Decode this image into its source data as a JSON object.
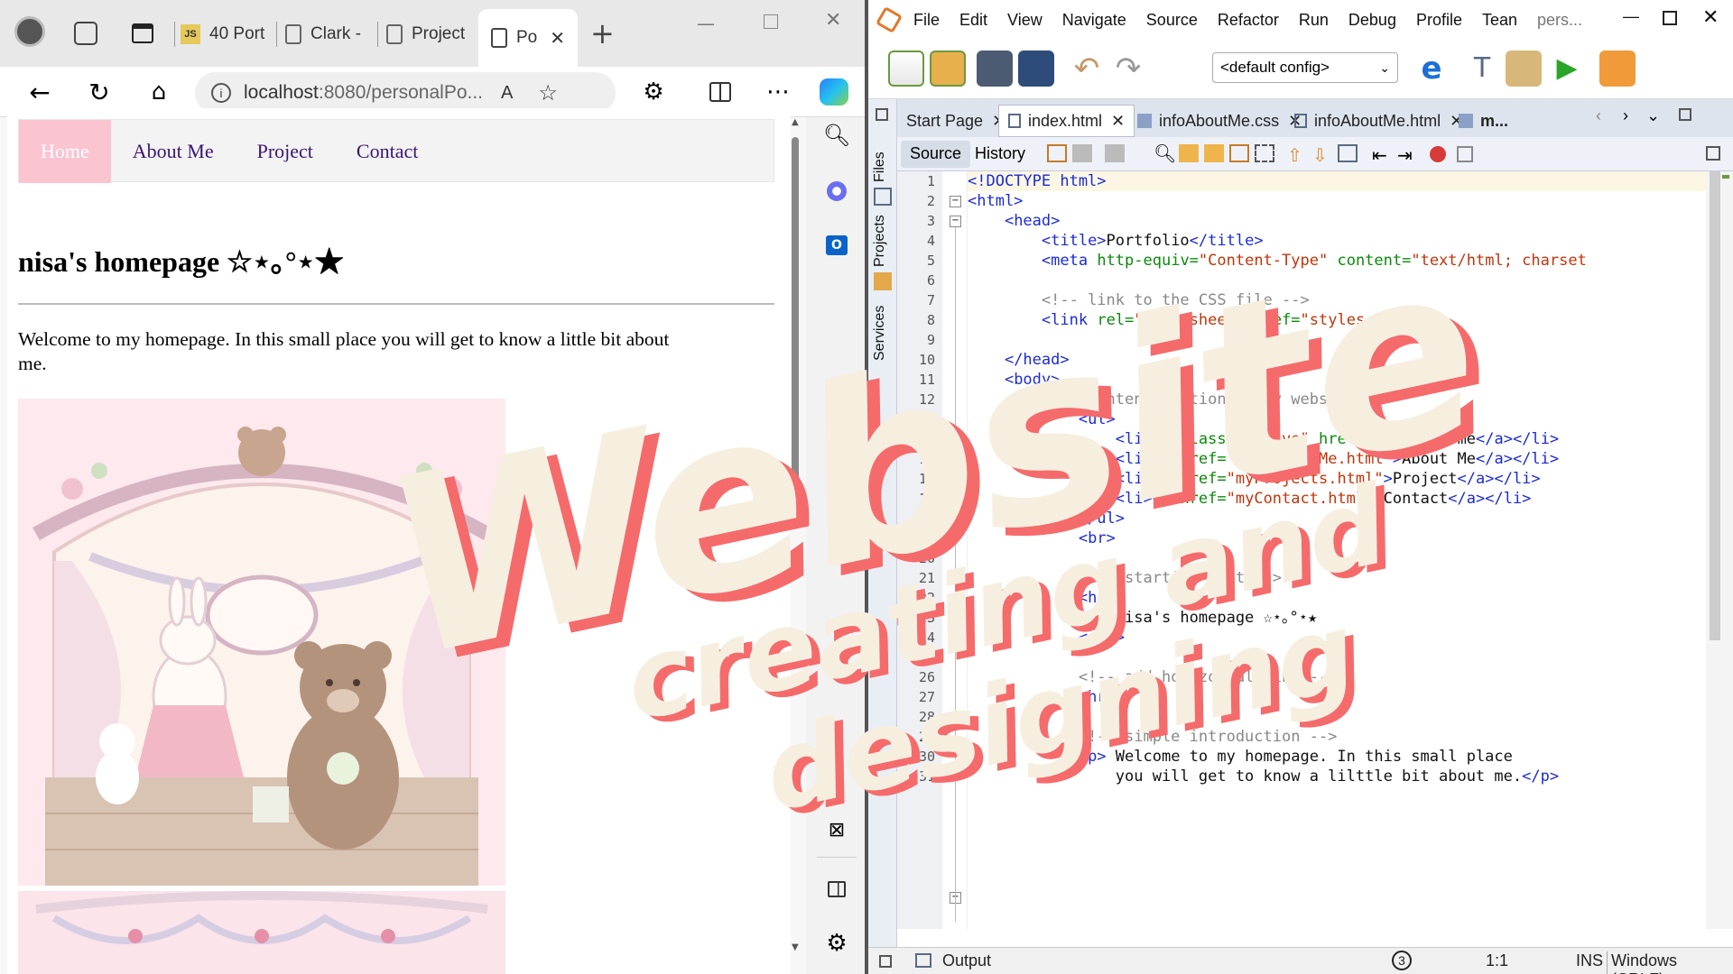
{
  "browser": {
    "tabs": [
      {
        "label": "40 Port",
        "icon": "js-icon"
      },
      {
        "label": "Clark -",
        "icon": "page-icon"
      },
      {
        "label": "Project",
        "icon": "page-icon"
      },
      {
        "label": "Po",
        "icon": "page-icon",
        "active": true
      }
    ],
    "url_host": "localhost",
    "url_rest": ":8080/personalPo...",
    "page": {
      "nav": [
        {
          "label": "Home",
          "active": true
        },
        {
          "label": "About Me"
        },
        {
          "label": "Project"
        },
        {
          "label": "Contact"
        }
      ],
      "title": "nisa's homepage ☆⋆｡°⋆★",
      "intro_line1": "Welcome to my homepage. In this small place you will get to know a little bit about",
      "intro_line2": "me."
    }
  },
  "ide": {
    "menu": [
      "File",
      "Edit",
      "View",
      "Navigate",
      "Source",
      "Refactor",
      "Run",
      "Debug",
      "Profile",
      "Tean",
      "pers..."
    ],
    "config": "<default config>",
    "side_tabs": [
      "Files",
      "Projects",
      "Services"
    ],
    "editor_tabs": [
      "Start Page",
      "index.html",
      "infoAboutMe.css",
      "infoAboutMe.html",
      "m..."
    ],
    "source_tab": "Source",
    "history_tab": "History",
    "code_lines": [
      {
        "n": "1",
        "html": "<span class='tag'>&lt;!DOCTYPE html&gt;</span>"
      },
      {
        "n": "2",
        "html": "<span class='tag'>&lt;html&gt;</span>"
      },
      {
        "n": "3",
        "html": "    <span class='tag'>&lt;head&gt;</span>"
      },
      {
        "n": "4",
        "html": "        <span class='tag'>&lt;title&gt;</span><span class='txt'>Portfolio</span><span class='tag'>&lt;/title&gt;</span>"
      },
      {
        "n": "5",
        "html": "        <span class='tag'>&lt;meta</span> <span class='att'>http-equiv=</span><span class='str'>\"Content-Type\"</span> <span class='att'>content=</span><span class='str'>\"text/html; charset</span>"
      },
      {
        "n": "6",
        "html": ""
      },
      {
        "n": "7",
        "html": "        <span class='com'>&lt;!-- link to the CSS file --&gt;</span>"
      },
      {
        "n": "8",
        "html": "        <span class='tag'>&lt;link</span> <span class='att'>rel=</span><span class='str'>\"stylesheet\"</span> <span class='att'>href=</span><span class='str'>\"styles.css\"</span><span class='tag'>&gt;</span>"
      },
      {
        "n": "9",
        "html": ""
      },
      {
        "n": "10",
        "html": "    <span class='tag'>&lt;/head&gt;</span>"
      },
      {
        "n": "11",
        "html": "    <span class='tag'>&lt;body&gt;</span>"
      },
      {
        "n": "12",
        "html": "        <span class='com'>&lt;!-- content section in my website --&gt;</span>"
      },
      {
        "n": "13",
        "html": "            <span class='tag'>&lt;ul&gt;</span>"
      },
      {
        "n": "14",
        "html": "                <span class='tag'>&lt;li&gt;&lt;a</span> <span class='att'>class=</span><span class='str'>\"active\"</span> <span class='att'>href=</span><span class='str'>\"#home\"</span><span class='tag'>&gt;</span><span class='txt'>Home</span><span class='tag'>&lt;/a&gt;&lt;/li&gt;</span>"
      },
      {
        "n": "15",
        "html": "                <span class='tag'>&lt;li&gt;&lt;a</span> <span class='att'>href=</span><span class='str'>\"infoAboutMe.html\"</span><span class='tag'>&gt;</span><span class='txt'>About Me</span><span class='tag'>&lt;/a&gt;&lt;/li&gt;</span>"
      },
      {
        "n": "16",
        "html": "                <span class='tag'>&lt;li&gt;&lt;a</span> <span class='att'>href=</span><span class='str'>\"myProjects.html\"</span><span class='tag'>&gt;</span><span class='txt'>Project</span><span class='tag'>&lt;/a&gt;&lt;/li&gt;</span>"
      },
      {
        "n": "17",
        "html": "                <span class='tag'>&lt;li&gt;&lt;a</span> <span class='att'>href=</span><span class='str'>\"myContact.html\"</span><span class='tag'>&gt;</span><span class='txt'>Contact</span><span class='tag'>&lt;/a&gt;&lt;/li&gt;</span>"
      },
      {
        "n": "18",
        "html": "            <span class='tag'>&lt;/ul&gt;</span>"
      },
      {
        "n": "19",
        "html": "            <span class='tag'>&lt;br&gt;</span>"
      },
      {
        "n": "20",
        "html": ""
      },
      {
        "n": "21",
        "html": "            <span class='com'>&lt;!-- starting text --&gt;</span>"
      },
      {
        "n": "22",
        "html": "            <span class='tag'>&lt;h1&gt;</span>"
      },
      {
        "n": "23",
        "html": "                <span class='txt'>nisa's homepage ☆⋆｡°⋆★</span>"
      },
      {
        "n": "24",
        "html": "            <span class='tag'>&lt;/h1&gt;</span>"
      },
      {
        "n": "25",
        "html": ""
      },
      {
        "n": "26",
        "html": "            <span class='com'>&lt;!-- add horizontal line --&gt;</span>"
      },
      {
        "n": "27",
        "html": "            <span class='tag'>&lt;hr&gt;</span>"
      },
      {
        "n": "28",
        "html": ""
      },
      {
        "n": "29",
        "html": "            <span class='com'>&lt;!-- simple introduction --&gt;</span>"
      },
      {
        "n": "30",
        "html": "            <span class='tag'>&lt;p&gt;</span><span class='txt'> Welcome to my homepage. In this small place</span>"
      },
      {
        "n": "31",
        "html": "                <span class='txt'>you will get to know a lilttle bit about me.</span><span class='tag'>&lt;/p&gt;</span>"
      }
    ],
    "status": {
      "output": "Output",
      "badge": "3",
      "position": "1:1",
      "mode": "INS",
      "eol": "Windows (CRLF)"
    }
  },
  "overlay": {
    "line1": "Website",
    "line2": "creating and",
    "line3": "designing"
  },
  "colors": {
    "accent_pink": "#fbc4d1",
    "overlay_fill": "#f6efe0",
    "overlay_shadow": "#f56b6b"
  }
}
